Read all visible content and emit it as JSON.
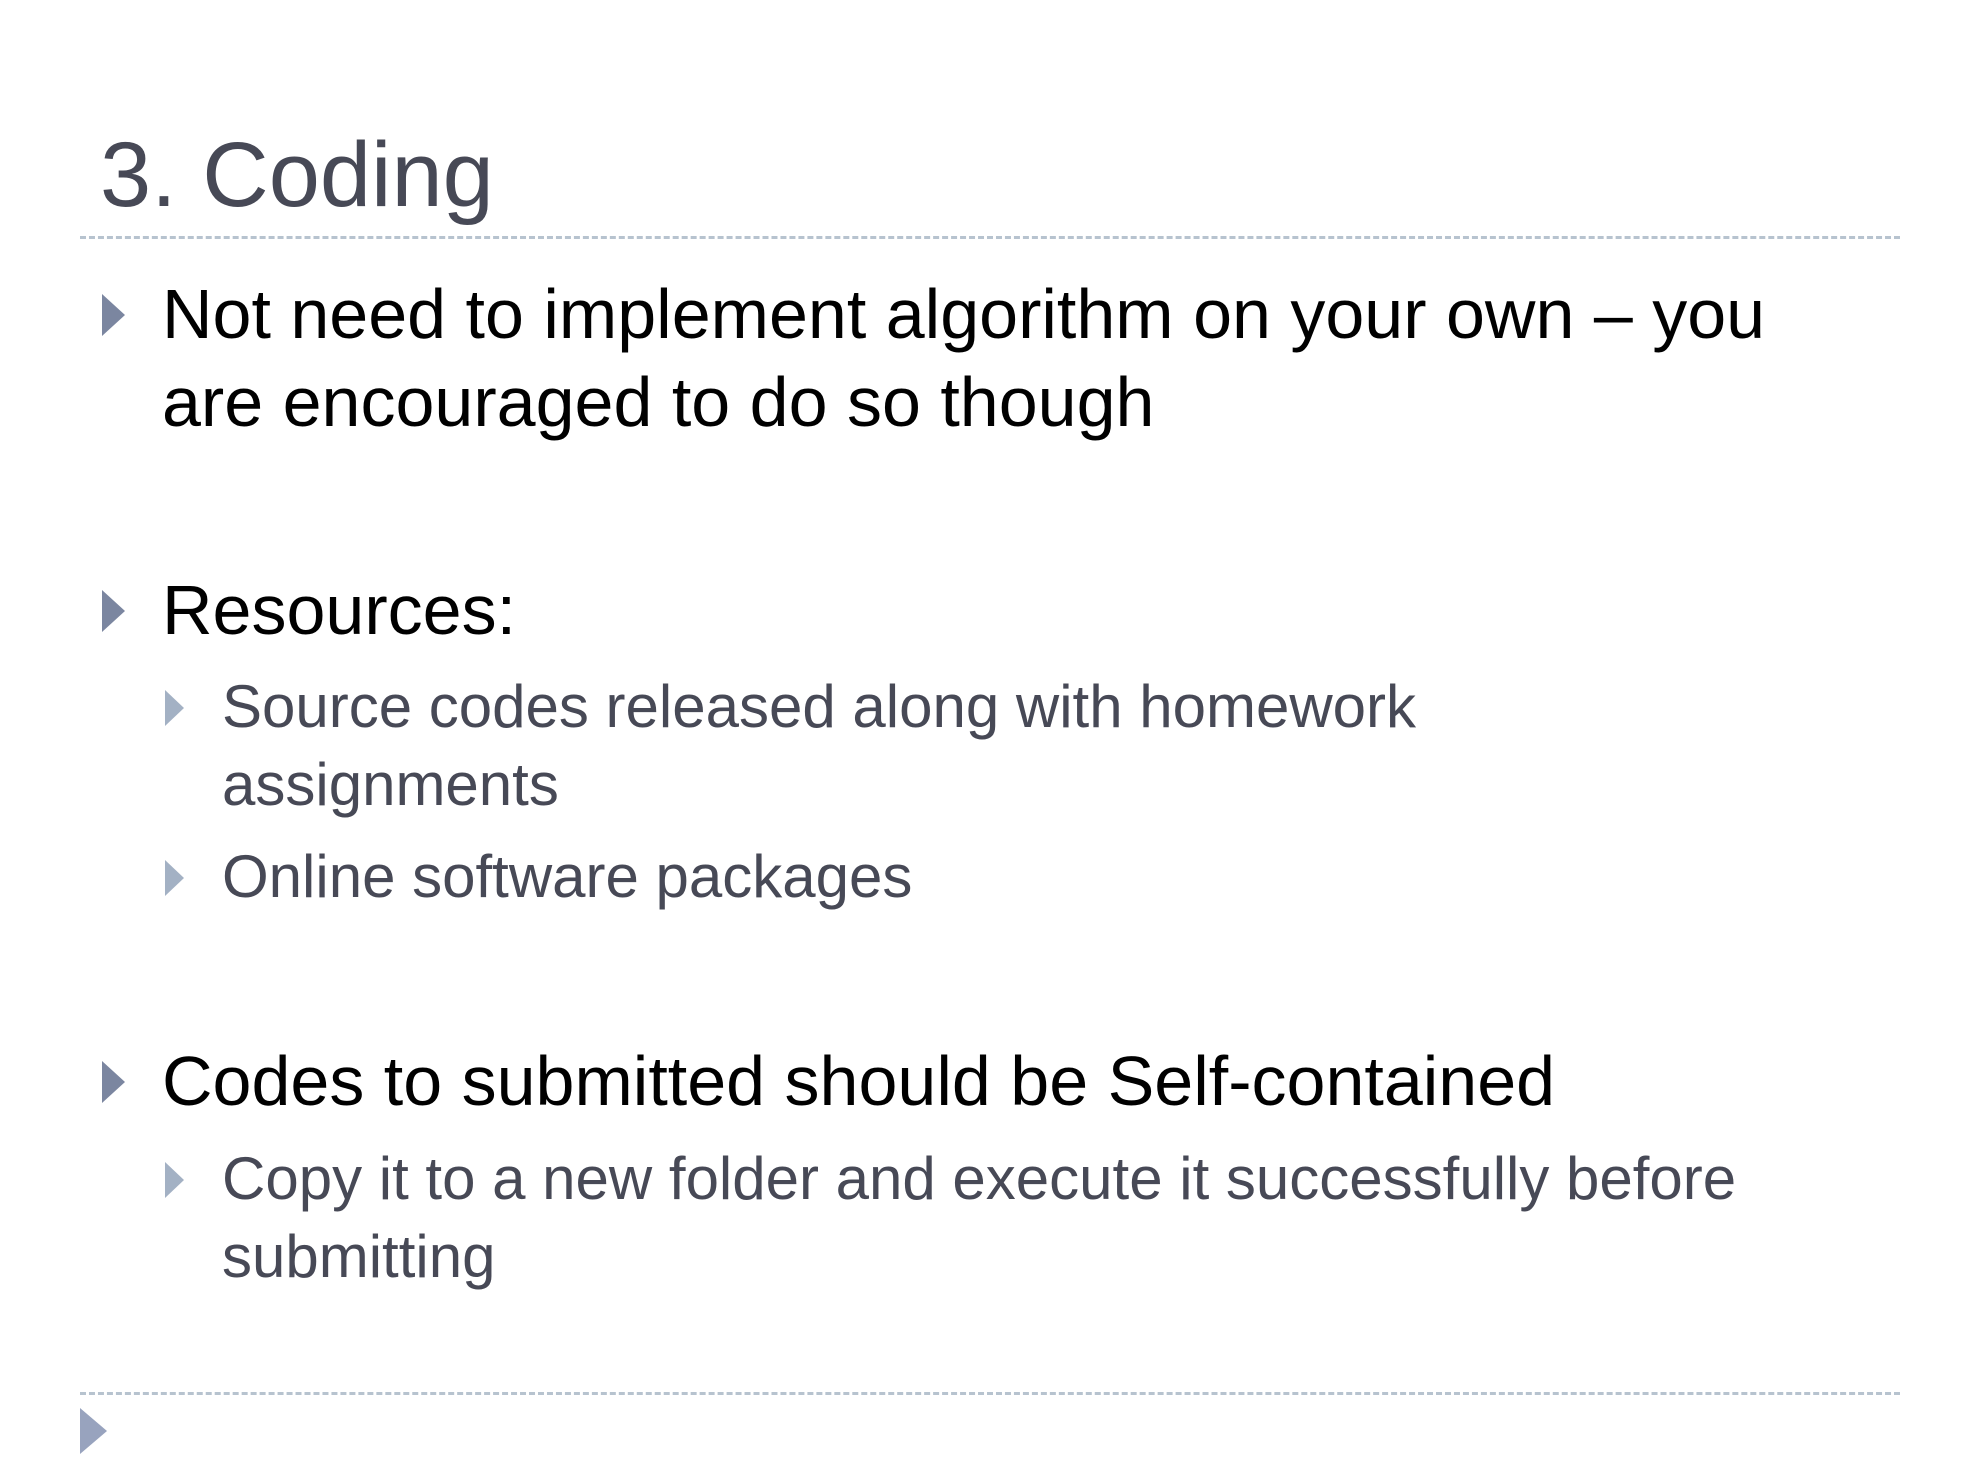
{
  "slide": {
    "title": "3. Coding",
    "bullets": {
      "b1": {
        "line1": " Not need to implement algorithm on your own – you",
        "line2": "are encouraged to do so though"
      },
      "b2": {
        "line1": "Resources:",
        "subs": {
          "s1": {
            "line1": " Source codes released along with homework",
            "line2": "assignments"
          },
          "s2": {
            "line1": " Online software packages"
          }
        }
      },
      "b3": {
        "line1": "Codes to submitted should be Self-contained",
        "subs": {
          "s1": {
            "line1": "Copy it to a new folder and execute it successfully before",
            "line2": "submitting"
          }
        }
      }
    }
  },
  "colors": {
    "title": "#474956",
    "body_text": "#000000",
    "sub_text": "#474956",
    "bullet_arrow": "#7b86a0",
    "sub_bullet_arrow": "#a3b1c4",
    "divider": "#b7c3cf"
  },
  "icons": {
    "bullet": "triangle-right-icon",
    "footer": "triangle-right-icon"
  }
}
